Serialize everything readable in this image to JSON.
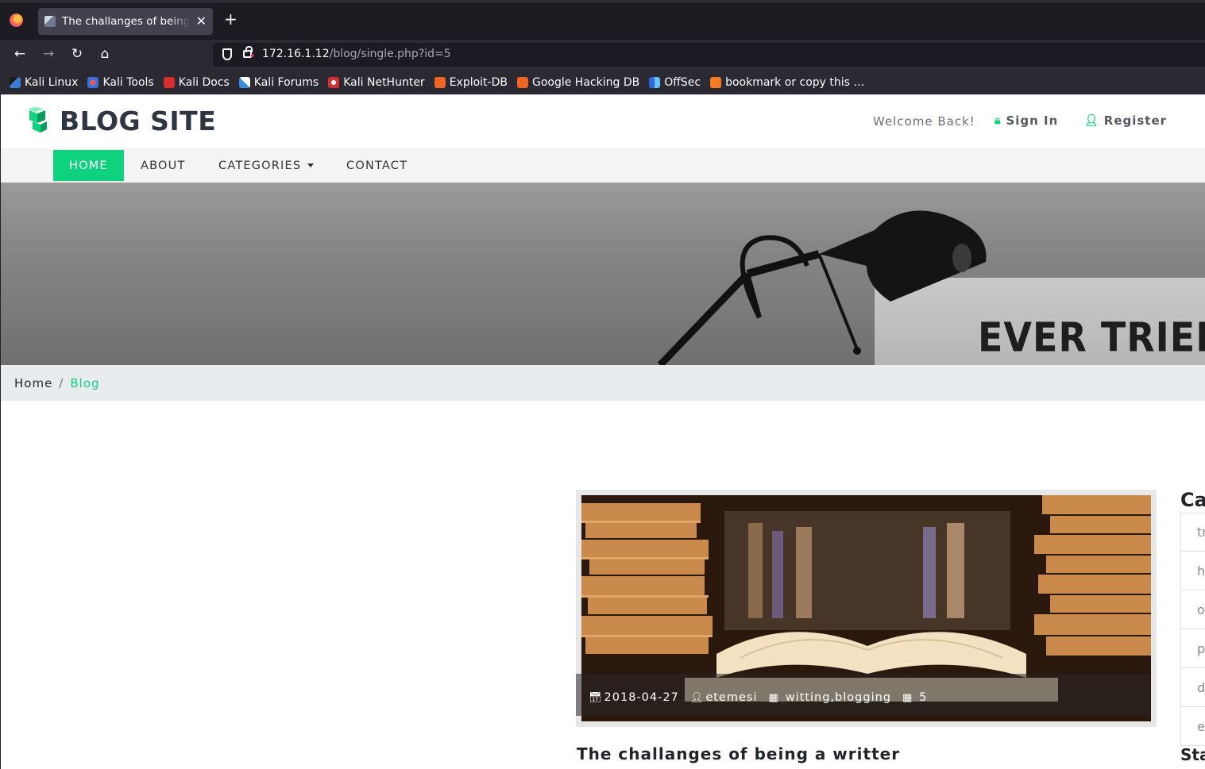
{
  "browser": {
    "tab_title": "The challanges of being a writter",
    "url_host": "172.16.1.12",
    "url_path": "/blog/single.php?id=5",
    "bookmarks": [
      {
        "label": "Kali Linux",
        "icon": "kali-icon"
      },
      {
        "label": "Kali Tools",
        "icon": "kali-tools-icon"
      },
      {
        "label": "Kali Docs",
        "icon": "kali-docs-icon"
      },
      {
        "label": "Kali Forums",
        "icon": "kali-forums-icon"
      },
      {
        "label": "Kali NetHunter",
        "icon": "nethunter-icon"
      },
      {
        "label": "Exploit-DB",
        "icon": "exploit-db-icon"
      },
      {
        "label": "Google Hacking DB",
        "icon": "ghdb-icon"
      },
      {
        "label": "OffSec",
        "icon": "offsec-icon"
      },
      {
        "label": "bookmark or copy this …",
        "icon": "bookmark-icon"
      }
    ]
  },
  "site": {
    "title": "BLOG SITE",
    "welcome": "Welcome Back!",
    "sign_in": "Sign In",
    "register": "Register",
    "accent_color": "#0fd27e"
  },
  "nav": {
    "home": "HOME",
    "about": "ABOUT",
    "categories": "CATEGORIES",
    "contact": "CONTACT"
  },
  "hero": {
    "text": "EVER TRIED."
  },
  "breadcrumb": {
    "home": "Home",
    "separator": "/",
    "current": "Blog"
  },
  "post": {
    "date": "2018-04-27",
    "author": "etemesi",
    "tags": "witting,blogging",
    "comments": "5",
    "title": "The challanges of being a writter"
  },
  "sidebar": {
    "categories_heading": "Ca",
    "categories": [
      "tr",
      "h",
      "o",
      "p",
      "d",
      "e"
    ],
    "stats_heading": "Sta"
  }
}
